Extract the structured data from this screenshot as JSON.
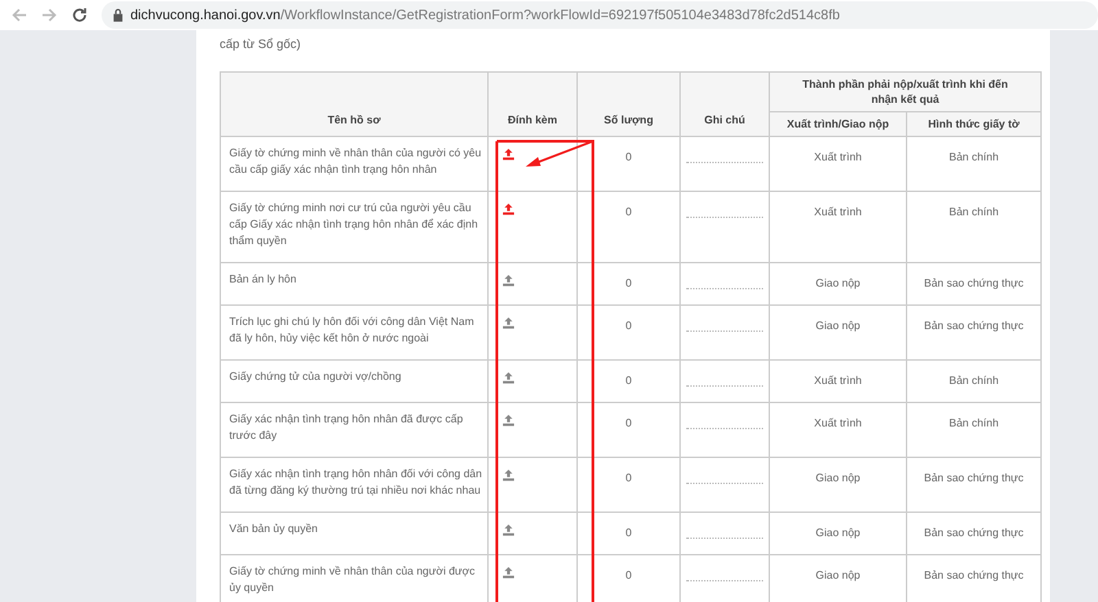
{
  "browser": {
    "url_host": "dichvucong.hanoi.gov.vn",
    "url_path": "/WorkflowInstance/GetRegistrationForm?workFlowId=692197f505104e3483d78fc2d514c8fb"
  },
  "intro_text": "cấp từ Sổ gốc)",
  "table": {
    "columns": {
      "name": "Tên hồ sơ",
      "attach": "Đính kèm",
      "quantity": "Số lượng",
      "note": "Ghi chú",
      "group": "Thành phần phải nộp/xuất trình khi đến nhận kết quả",
      "submit": "Xuất trình/Giao nộp",
      "form": "Hình thức giấy tờ"
    },
    "rows": [
      {
        "name": "Giấy tờ chứng minh về nhân thân của người có yêu cầu cấp giấy xác nhận tình trạng hôn nhân",
        "required": true,
        "quantity": "0",
        "submit": "Xuất trình",
        "form": "Bản chính"
      },
      {
        "name": "Giấy tờ chứng minh nơi cư trú của người yêu cầu cấp Giấy xác nhận tình trạng hôn nhân để xác định thẩm quyền",
        "required": true,
        "quantity": "0",
        "submit": "Xuất trình",
        "form": "Bản chính"
      },
      {
        "name": "Bản án ly hôn",
        "required": false,
        "quantity": "0",
        "submit": "Giao nộp",
        "form": "Bản sao chứng thực"
      },
      {
        "name": "Trích lục ghi chú ly hôn đối với công dân Việt Nam đã ly hôn, hủy việc kết hôn ở nước ngoài",
        "required": false,
        "quantity": "0",
        "submit": "Giao nộp",
        "form": "Bản sao chứng thực"
      },
      {
        "name": "Giấy chứng tử của người vợ/chồng",
        "required": false,
        "quantity": "0",
        "submit": "Xuất trình",
        "form": "Bản chính"
      },
      {
        "name": "Giấy xác nhận tình trạng hôn nhân đã được cấp trước đây",
        "required": false,
        "quantity": "0",
        "submit": "Xuất trình",
        "form": "Bản chính"
      },
      {
        "name": "Giấy xác nhận tình trạng hôn nhân đối với công dân đã từng đăng ký thường trú tại nhiều nơi khác nhau",
        "required": false,
        "quantity": "0",
        "submit": "Giao nộp",
        "form": "Bản sao chứng thực"
      },
      {
        "name": "Văn bản ủy quyền",
        "required": false,
        "quantity": "0",
        "submit": "Giao nộp",
        "form": "Bản sao chứng thực"
      },
      {
        "name": "Giấy tờ chứng minh về nhân thân của người được ủy quyền",
        "required": false,
        "quantity": "0",
        "submit": "Giao nộp",
        "form": "Bản sao chứng thực"
      }
    ]
  }
}
